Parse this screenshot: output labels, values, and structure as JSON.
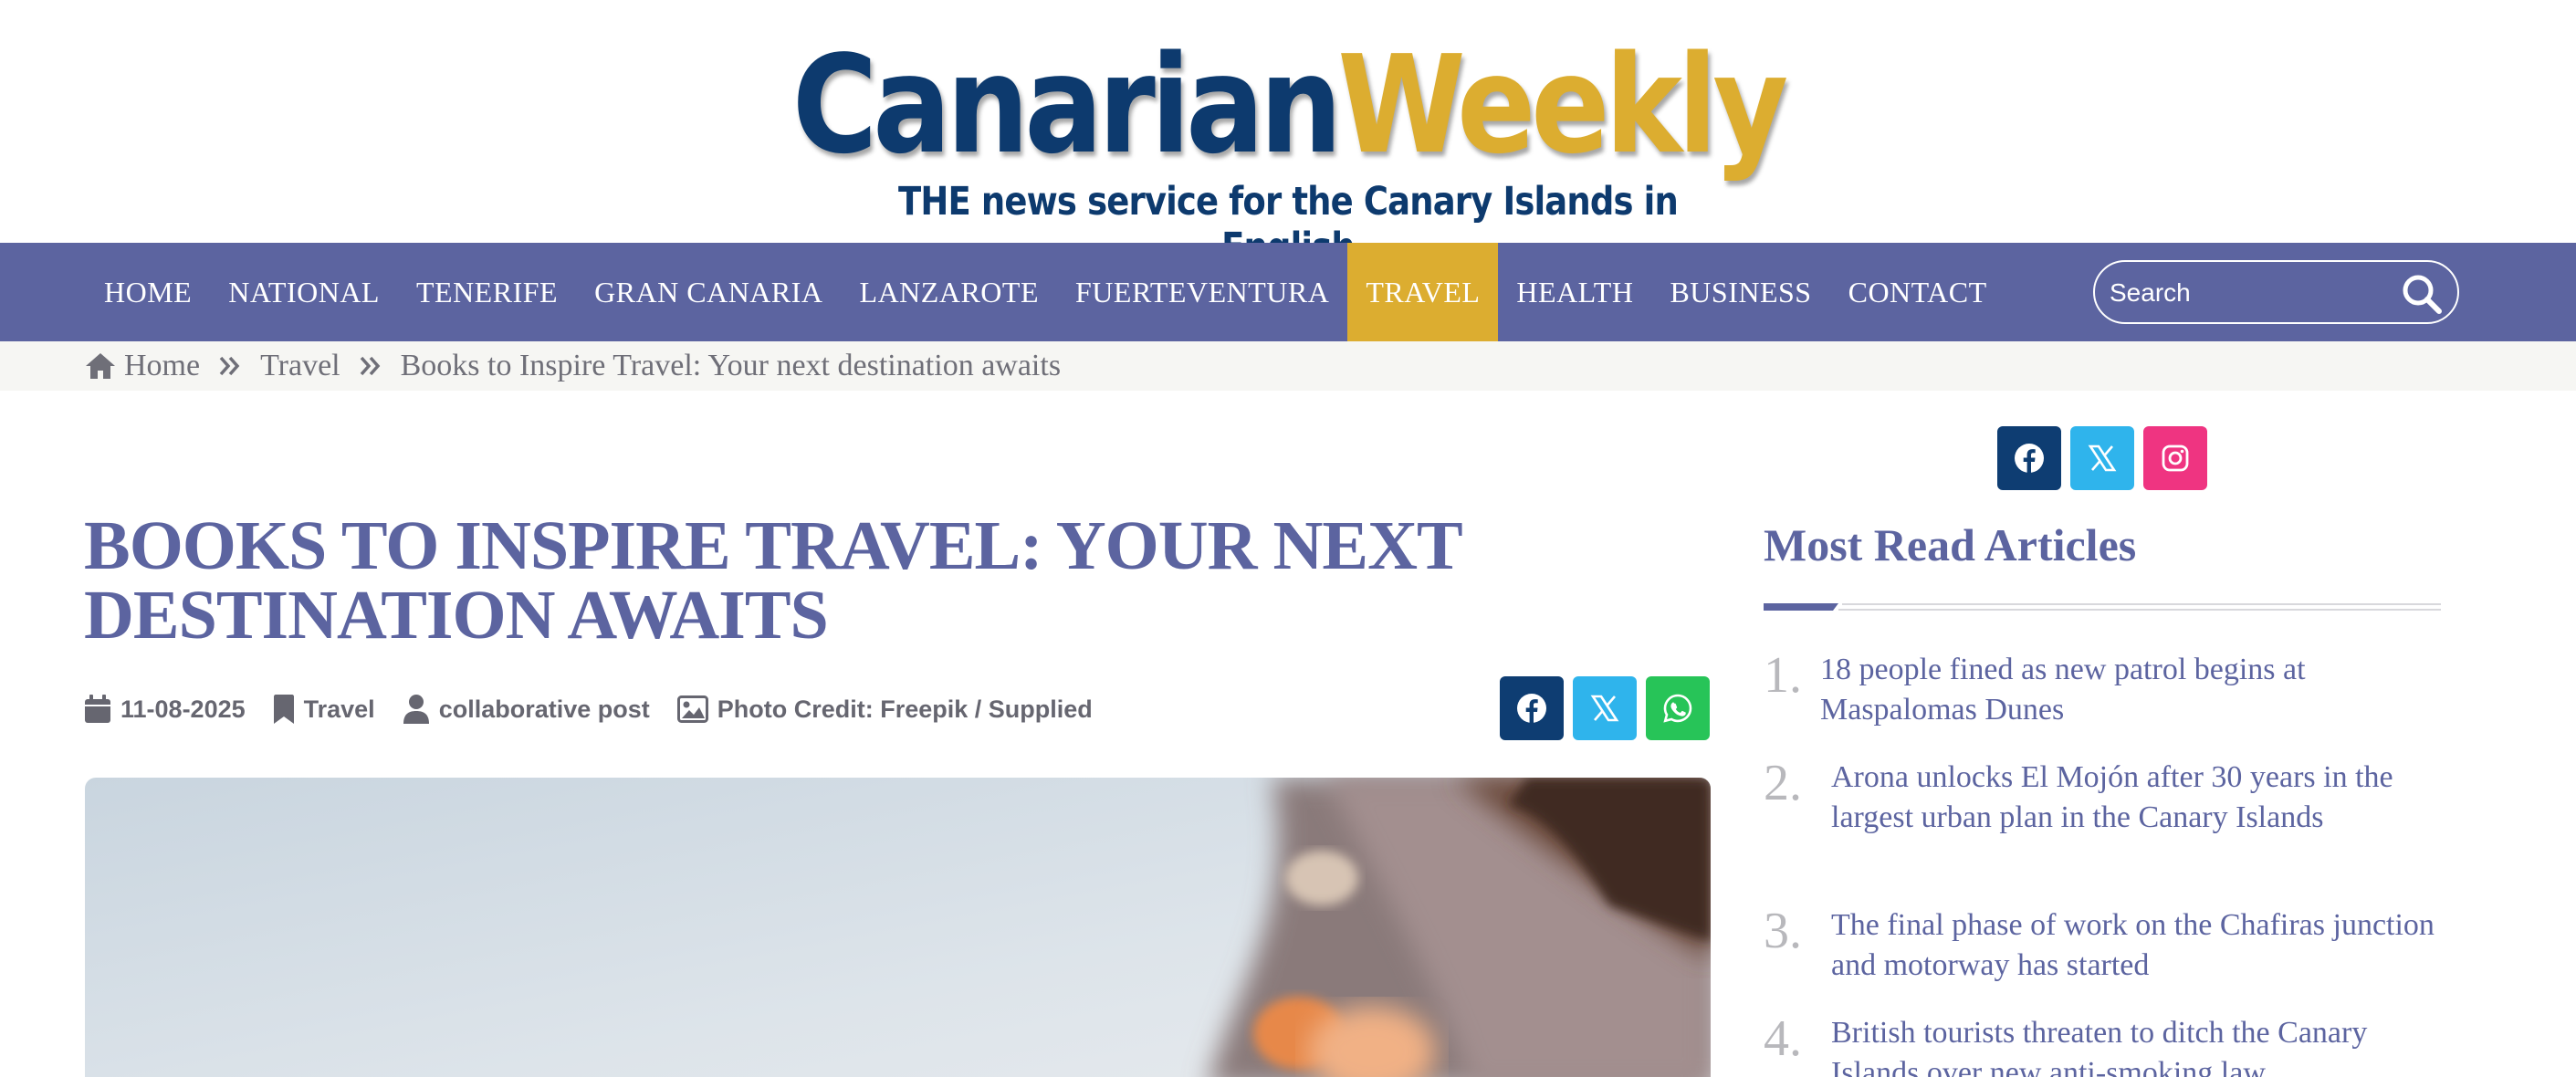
{
  "logo": {
    "part1": "Canarian",
    "part2": "Weekly",
    "tagline": "THE news service for the Canary Islands in English"
  },
  "nav": {
    "items": [
      {
        "label": "HOME",
        "active": false
      },
      {
        "label": "NATIONAL",
        "active": false
      },
      {
        "label": "TENERIFE",
        "active": false
      },
      {
        "label": "GRAN CANARIA",
        "active": false
      },
      {
        "label": "LANZAROTE",
        "active": false
      },
      {
        "label": "FUERTEVENTURA",
        "active": false
      },
      {
        "label": "TRAVEL",
        "active": true
      },
      {
        "label": "HEALTH",
        "active": false
      },
      {
        "label": "BUSINESS",
        "active": false
      },
      {
        "label": "CONTACT",
        "active": false
      }
    ],
    "search_placeholder": "Search"
  },
  "breadcrumb": {
    "home": "Home",
    "section": "Travel",
    "current": "Books to Inspire Travel: Your next destination awaits"
  },
  "article": {
    "title": "Books to Inspire Travel: Your next destination awaits",
    "date": "11-08-2025",
    "category": "Travel",
    "author": "collaborative post",
    "photo_credit": "Photo Credit: Freepik / Supplied"
  },
  "sidebar": {
    "heading": "Most Read Articles",
    "items": [
      {
        "num": "1.",
        "text": "18 people fined as new patrol begins at Maspalomas Dunes"
      },
      {
        "num": "2.",
        "text": "Arona unlocks El Mojón after 30 years in the largest urban plan in the Canary Islands"
      },
      {
        "num": "3.",
        "text": "The final phase of work on the Chafiras junction and motorway has started"
      },
      {
        "num": "4.",
        "text": "British tourists threaten to ditch the Canary Islands over new anti-smoking law"
      }
    ]
  },
  "colors": {
    "brand_blue": "#5c64a0",
    "brand_gold": "#dcad30",
    "logo_navy": "#0d3a6e",
    "facebook": "#0e3d72",
    "x": "#2fb4ec",
    "instagram": "#ef3481",
    "whatsapp": "#27c458"
  },
  "icons": {
    "social_top": [
      "facebook-icon",
      "x-icon",
      "instagram-icon"
    ],
    "social_share": [
      "facebook-icon",
      "x-icon",
      "whatsapp-icon"
    ],
    "meta": [
      "calendar-icon",
      "bookmark-icon",
      "user-icon",
      "image-icon"
    ]
  }
}
